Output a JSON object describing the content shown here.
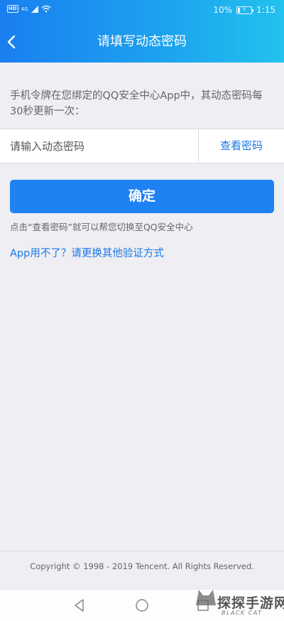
{
  "status_bar": {
    "hd": "HD",
    "network": "4G",
    "battery_percent": "10%",
    "battery_level": 0.1,
    "time": "1:15"
  },
  "nav": {
    "title": "请填写动态密码",
    "back_icon": "chevron-left-icon"
  },
  "form": {
    "description": "手机令牌在您绑定的QQ安全中心App中，其动态密码每30秒更新一次：",
    "password_placeholder": "请输入动态密码",
    "password_value": "",
    "view_password_label": "查看密码",
    "confirm_label": "确定",
    "hint": "点击“查看密码”就可以帮您切换至QQ安全中心",
    "alt_method_link": "App用不了？请更换其他验证方式"
  },
  "footer": {
    "copyright": "Copyright © 1998 - 2019 Tencent. All Rights Reserved."
  },
  "system_nav": {
    "back_icon": "triangle-back-icon",
    "home_icon": "circle-home-icon",
    "recent_icon": "square-recent-icon"
  },
  "watermark": {
    "text": "探探手游网",
    "sub": "BLACK CAT"
  },
  "colors": {
    "header_gradient_start": "#1a7ff0",
    "header_gradient_end": "#22c2ee",
    "accent": "#1f82f3",
    "link": "#1a77e6",
    "background": "#eeeef3"
  }
}
